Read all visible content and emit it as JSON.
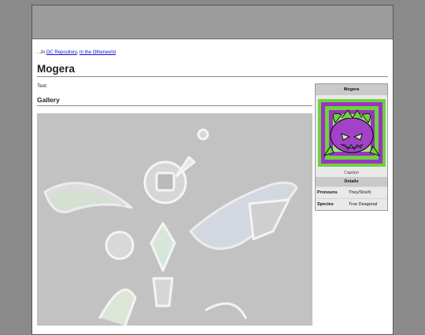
{
  "breadcrumb": {
    "prefix": "...In",
    "links": [
      "OC Repository",
      "In the Otherworld"
    ],
    "separator": ", "
  },
  "page": {
    "title": "Mogera",
    "intro_text": "Text"
  },
  "gallery": {
    "heading": "Gallery",
    "image_icon": "crystal-fairy-drawing"
  },
  "infobox": {
    "title": "Mogera",
    "image_icon": "purple-monster-portrait",
    "caption": "Caption",
    "section_label": "Details",
    "rows": [
      {
        "label": "Pronouns",
        "value": "They/She/It"
      },
      {
        "label": "Species",
        "value": "True Deagonal"
      }
    ]
  },
  "colors": {
    "background": "#8a8a8a",
    "header": "#9c9c9c",
    "link": "#0b0bcc",
    "infobox_header": "#c9c9c9",
    "portrait_purple": "#9a33c4",
    "portrait_green": "#6fd13c"
  }
}
